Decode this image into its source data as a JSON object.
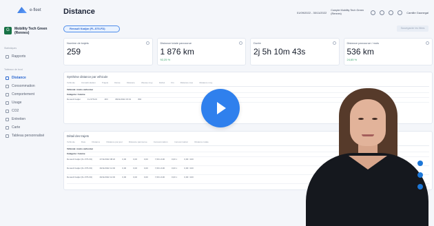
{
  "brand": {
    "name": "e-fleet"
  },
  "company": {
    "name": "Mobility Tech Green (Rennes)",
    "badge": "G"
  },
  "sidebar": {
    "section_analysis": "Statistiques",
    "section_reports": "Tableaux de bord",
    "items": [
      {
        "label": "Rapports"
      },
      {
        "label": "Distance"
      },
      {
        "label": "Consommation"
      },
      {
        "label": "Comportement"
      },
      {
        "label": "Usage"
      },
      {
        "label": "CO2"
      },
      {
        "label": "Entretien"
      },
      {
        "label": "Carte"
      },
      {
        "label": "Tableau personnalisé"
      }
    ]
  },
  "header": {
    "title": "Distance",
    "date_range": "01/09/2022 - 30/11/2022",
    "unit": "Compte Mobility Tech Green (Rennes)",
    "user": "Camille Gaonegal"
  },
  "filters": {
    "vehicle_chip": "Renault Kadjar (FL-575-FD)",
    "save_view": "Sauvegarder les filtres"
  },
  "kpis": [
    {
      "label": "Nombre de trajets",
      "value": "259",
      "delta": ""
    },
    {
      "label": "Distance totale parcourue",
      "value": "1 876 km",
      "delta": "92,25 %"
    },
    {
      "label": "Durée",
      "value": "2j 5h 10m 43s",
      "delta": ""
    },
    {
      "label": "Distance parcourue / mois",
      "value": "536 km",
      "delta": "24,65 %"
    }
  ],
  "synthesis": {
    "title": "Synthèse distance par véhicule",
    "columns": [
      "Véhicule",
      "Immatriculation",
      "Trajets",
      "Durée",
      "Distance",
      "Vitesse moy.",
      "Début",
      "Fin",
      "Distance max",
      "Distance moy."
    ],
    "rows": [
      [
        "Véhicule: moins carbonisé",
        "",
        "",
        "",
        "",
        "",
        "",
        "",
        "",
        ""
      ],
      [
        "Catégorie: Cuisine",
        "",
        "",
        "",
        "",
        "",
        "",
        "",
        "",
        ""
      ],
      [
        "Renault Kadjar",
        "FL-575-FD",
        "18 h",
        "",
        "",
        "",
        "08/11/2022 15:01",
        "",
        "",
        "894"
      ]
    ]
  },
  "details": {
    "title": "Détail des trajets",
    "columns": [
      "Véhicule",
      "Date",
      "Distance",
      "Distance par jour",
      "Distance parcourue",
      "Consommation",
      "Consommation",
      "Distance totale",
      "Coût",
      "Total"
    ],
    "rows": [
      [
        "Véhicule: moins carbonisé",
        "",
        "",
        "",
        "",
        "",
        "",
        "",
        "",
        ""
      ],
      [
        "Catégorie: Cuisine",
        "",
        "",
        "",
        "",
        "",
        "",
        "",
        "",
        ""
      ],
      [
        "Renault Kadjar (FL-575-FD)",
        "17/11/2022 08:20",
        "0,00",
        "0,00",
        "0,00",
        "7,69 L/100",
        "0,00 L",
        "0,00 / 100",
        "",
        ""
      ],
      [
        "Renault Kadjar (FL-575-FD)",
        "16/11/2022 14:00",
        "0,00",
        "0,00",
        "0,00",
        "7,69 L/100",
        "0,00 L",
        "0,00 / 100",
        "",
        ""
      ],
      [
        "Renault Kadjar (FL-575-FD)",
        "16/11/2022 12:00",
        "0,00",
        "0,00",
        "0,00",
        "7,69 L/100",
        "0,00 L",
        "0,00 / 100",
        "",
        ""
      ]
    ]
  },
  "video": {
    "icon": "play-icon"
  }
}
